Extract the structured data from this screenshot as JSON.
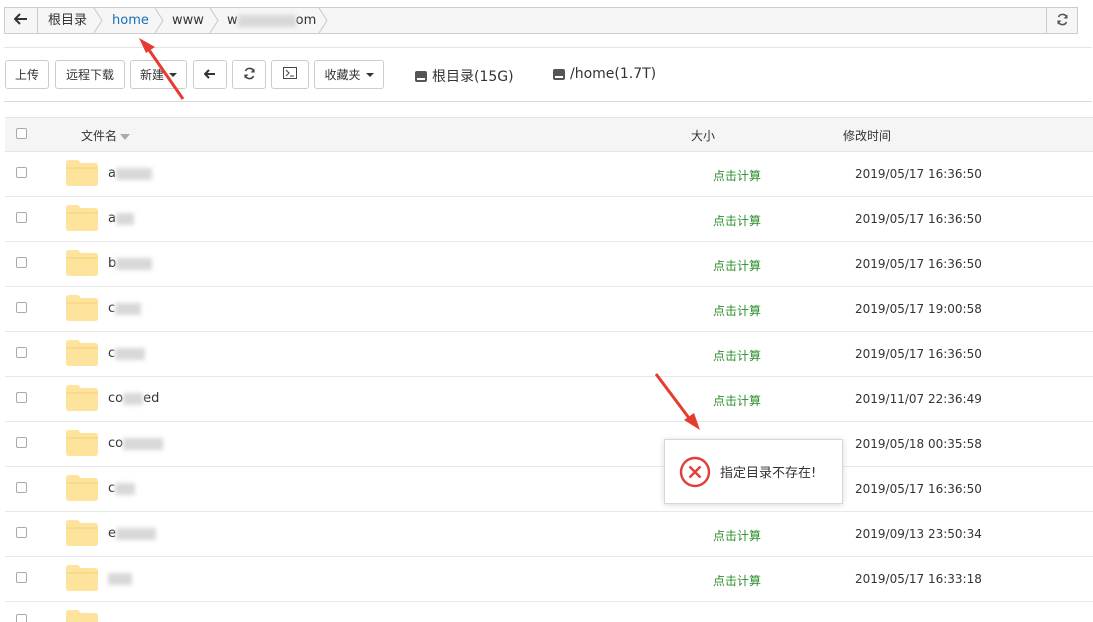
{
  "breadcrumb": {
    "back_icon": "arrow-left-icon",
    "items": [
      "根目录",
      "home",
      "www",
      "w",
      "om"
    ],
    "refresh_icon": "refresh-icon"
  },
  "toolbar": {
    "upload": "上传",
    "remote_download": "远程下载",
    "new": "新建",
    "favorites": "收藏夹",
    "disks": [
      "根目录(15G)",
      "/home(1.7T)"
    ]
  },
  "table": {
    "columns": {
      "name": "文件名",
      "size": "大小",
      "mtime": "修改时间"
    },
    "rows": [
      {
        "name": "a",
        "size": "点击计算",
        "mtime": "2019/05/17 16:36:50"
      },
      {
        "name": "a",
        "size": "点击计算",
        "mtime": "2019/05/17 16:36:50"
      },
      {
        "name": "b",
        "size": "点击计算",
        "mtime": "2019/05/17 16:36:50"
      },
      {
        "name": "c",
        "size": "点击计算",
        "mtime": "2019/05/17 19:00:58"
      },
      {
        "name": "c",
        "size": "点击计算",
        "mtime": "2019/05/17 16:36:50"
      },
      {
        "name": "co",
        "size": "点击计算",
        "mtime": "2019/11/07 22:36:49",
        "suffix": "ed"
      },
      {
        "name": "co",
        "size": "",
        "mtime": "2019/05/18 00:35:58"
      },
      {
        "name": "c",
        "size": "",
        "mtime": "2019/05/17 16:36:50"
      },
      {
        "name": "e",
        "size": "点击计算",
        "mtime": "2019/09/13 23:50:34"
      },
      {
        "name": "",
        "size": "点击计算",
        "mtime": "2019/05/17 16:33:18"
      }
    ]
  },
  "toast": {
    "message": "指定目录不存在!",
    "icon": "error-circle-icon"
  },
  "colors": {
    "link": "#1a6fb3",
    "calc": "#2d8f2d",
    "folder": "#fde39b",
    "error": "#e0403a",
    "arrow": "#e53b30"
  }
}
